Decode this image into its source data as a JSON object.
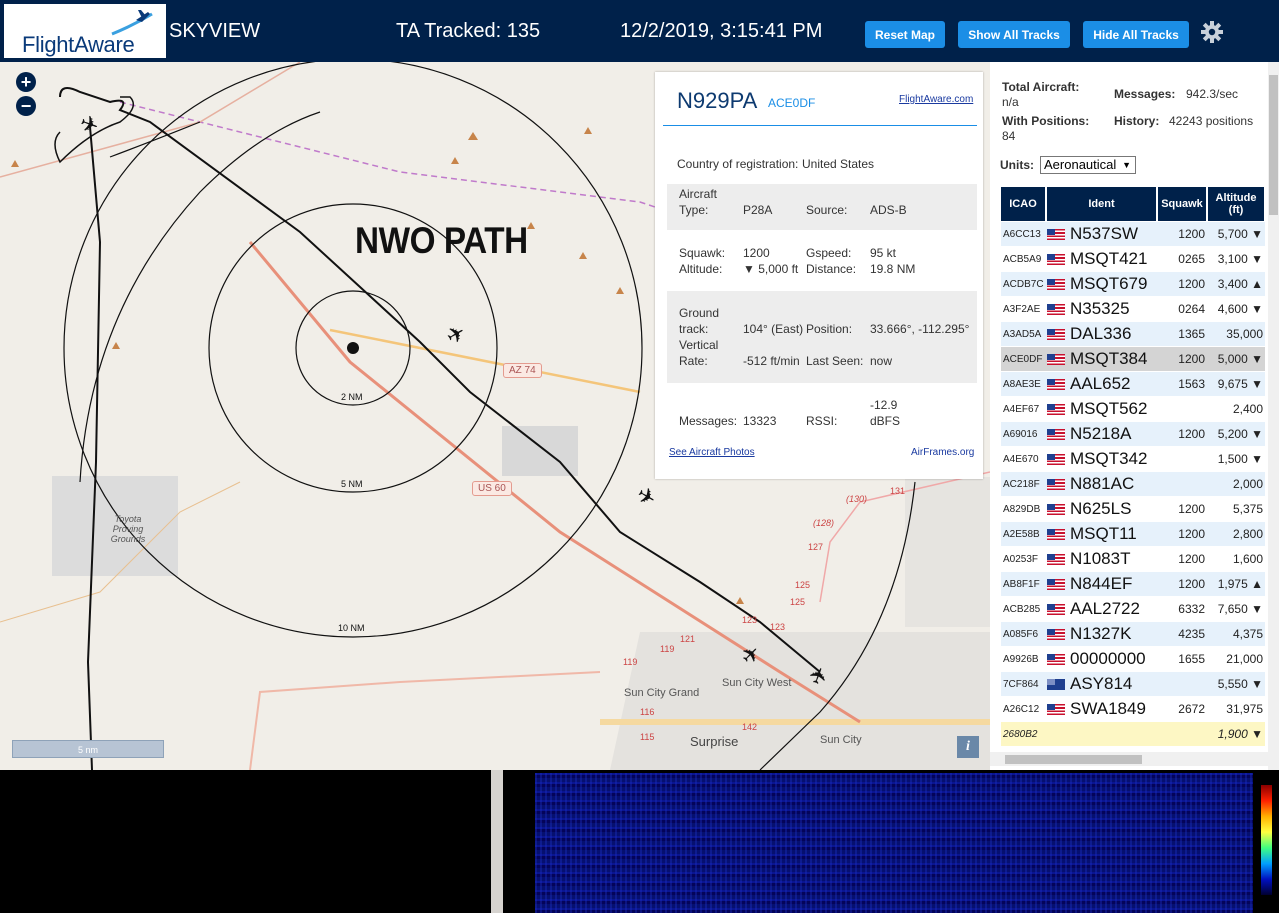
{
  "header": {
    "logo_text": "FlightAware",
    "site_name": "SKYVIEW",
    "tracked": "TA Tracked: 135",
    "datetime": "12/2/2019, 3:15:41 PM",
    "buttons": {
      "reset": "Reset Map",
      "show_all": "Show All Tracks",
      "hide_all": "Hide All Tracks"
    },
    "settings_icon": "gear-icon"
  },
  "map": {
    "annotation": "NWO PATH",
    "rings": [
      "2 NM",
      "5 NM",
      "10 NM"
    ],
    "places": [
      "Toyota Proving Grounds",
      "Sun City Grand",
      "Sun City West",
      "Surprise",
      "Sun City"
    ],
    "highways": [
      "AZ 74",
      "US 60"
    ],
    "road_numbers": [
      "(130)",
      "131",
      "(128)",
      "127",
      "125",
      "125",
      "123",
      "123",
      "121",
      "119",
      "119",
      "116",
      "115",
      "142"
    ],
    "scale": "5 nm",
    "zoom_in_icon": "plus-icon",
    "zoom_out_icon": "minus-icon",
    "info_icon": "info-icon"
  },
  "detail": {
    "callsign": "N929PA",
    "hex": "ACE0DF",
    "link": "FlightAware.com",
    "country_label": "Country of registration:",
    "country": "United States",
    "aircraft_label": "Aircraft",
    "type_label": "Type:",
    "type": "P28A",
    "source_label": "Source:",
    "source": "ADS-B",
    "squawk_label": "Squawk:",
    "squawk": "1200",
    "gspeed_label": "Gspeed:",
    "gspeed": "95 kt",
    "altitude_label": "Altitude:",
    "altitude": "▼ 5,000 ft",
    "distance_label": "Distance:",
    "distance": "19.8 NM",
    "ground_label": "Ground",
    "track_label": "track:",
    "track": "104° (East)",
    "position_label": "Position:",
    "position": "33.666°, -112.295°",
    "vertical_label": "Vertical",
    "rate_label": "Rate:",
    "rate": "-512 ft/min",
    "lastseen_label": "Last Seen:",
    "lastseen": "now",
    "messages_label": "Messages:",
    "messages": "13323",
    "rssi_label": "RSSI:",
    "rssi_value": "-12.9",
    "rssi_unit": "dBFS",
    "photos_link": "See Aircraft Photos",
    "airframes_link": "AirFrames.org"
  },
  "stats": {
    "total_label": "Total Aircraft:",
    "total": "n/a",
    "messages_label": "Messages:",
    "messages": "942.3/sec",
    "positions_label": "With Positions:",
    "positions": "84",
    "history_label": "History:",
    "history": "42243 positions",
    "units_label": "Units:",
    "units": "Aeronautical"
  },
  "table": {
    "headers": {
      "icao": "ICAO",
      "ident": "Ident",
      "squawk": "Squawk",
      "altitude": "Altitude (ft)"
    },
    "rows": [
      {
        "icao": "A6CC13",
        "flag": "us",
        "ident": "N537SW",
        "squawk": "1200",
        "alt": "5,700 ▼"
      },
      {
        "icao": "ACB5A9",
        "flag": "us",
        "ident": "MSQT421",
        "squawk": "0265",
        "alt": "3,100 ▼"
      },
      {
        "icao": "ACDB7C",
        "flag": "us",
        "ident": "MSQT679",
        "squawk": "1200",
        "alt": "3,400 ▲"
      },
      {
        "icao": "A3F2AE",
        "flag": "us",
        "ident": "N35325",
        "squawk": "0264",
        "alt": "4,600 ▼"
      },
      {
        "icao": "A3AD5A",
        "flag": "us",
        "ident": "DAL336",
        "squawk": "1365",
        "alt": "35,000"
      },
      {
        "icao": "ACE0DF",
        "flag": "us",
        "ident": "MSQT384",
        "squawk": "1200",
        "alt": "5,000 ▼",
        "selected": true
      },
      {
        "icao": "A8AE3E",
        "flag": "us",
        "ident": "AAL652",
        "squawk": "1563",
        "alt": "9,675 ▼"
      },
      {
        "icao": "A4EF67",
        "flag": "us",
        "ident": "MSQT562",
        "squawk": "",
        "alt": "2,400"
      },
      {
        "icao": "A69016",
        "flag": "us",
        "ident": "N5218A",
        "squawk": "1200",
        "alt": "5,200 ▼"
      },
      {
        "icao": "A4E670",
        "flag": "us",
        "ident": "MSQT342",
        "squawk": "",
        "alt": "1,500 ▼"
      },
      {
        "icao": "AC218F",
        "flag": "us",
        "ident": "N881AC",
        "squawk": "",
        "alt": "2,000"
      },
      {
        "icao": "A829DB",
        "flag": "us",
        "ident": "N625LS",
        "squawk": "1200",
        "alt": "5,375"
      },
      {
        "icao": "A2E58B",
        "flag": "us",
        "ident": "MSQT11",
        "squawk": "1200",
        "alt": "2,800"
      },
      {
        "icao": "A0253F",
        "flag": "us",
        "ident": "N1083T",
        "squawk": "1200",
        "alt": "1,600"
      },
      {
        "icao": "AB8F1F",
        "flag": "us",
        "ident": "N844EF",
        "squawk": "1200",
        "alt": "1,975 ▲"
      },
      {
        "icao": "ACB285",
        "flag": "us",
        "ident": "AAL2722",
        "squawk": "6332",
        "alt": "7,650 ▼"
      },
      {
        "icao": "A085F6",
        "flag": "us",
        "ident": "N1327K",
        "squawk": "4235",
        "alt": "4,375"
      },
      {
        "icao": "A9926B",
        "flag": "us",
        "ident": "00000000",
        "squawk": "1655",
        "alt": "21,000"
      },
      {
        "icao": "7CF864",
        "flag": "au",
        "ident": "ASY814",
        "squawk": "",
        "alt": "5,550 ▼"
      },
      {
        "icao": "A26C12",
        "flag": "us",
        "ident": "SWA1849",
        "squawk": "2672",
        "alt": "31,975"
      },
      {
        "icao": "2680B2",
        "flag": "",
        "ident": "",
        "squawk": "",
        "alt": "1,900 ▼",
        "highlight": true
      }
    ]
  },
  "colors": {
    "header_bg": "#00214a",
    "button": "#1b8ee6",
    "table_header": "#00214a",
    "row_alt": "#e6f1fb"
  }
}
